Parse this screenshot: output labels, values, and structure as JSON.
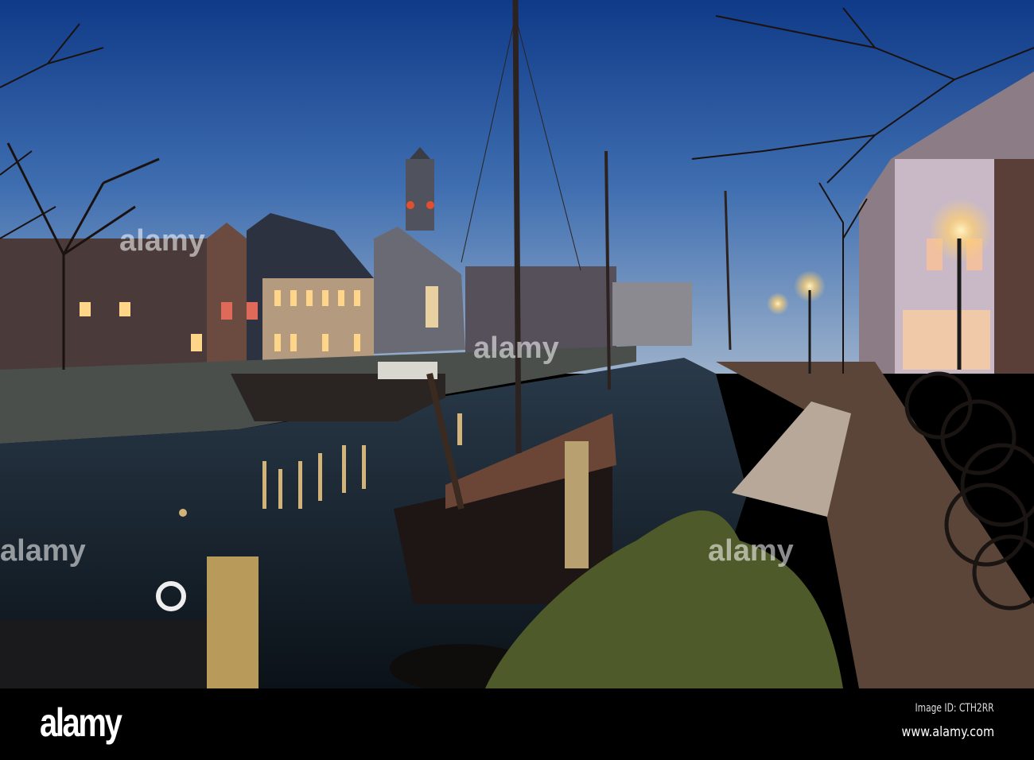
{
  "photo": {
    "subject": "canal-harbour-at-dusk",
    "colors": {
      "sky_top": "#123f8f",
      "sky_horizon": "#8aa6c6",
      "water": "#15202a",
      "lamp_light": "#ffd98a"
    }
  },
  "watermark": {
    "text": "alamy"
  },
  "footer": {
    "logo": "alamy",
    "image_id": "Image ID: CTH2RR",
    "url": "www.alamy.com"
  }
}
